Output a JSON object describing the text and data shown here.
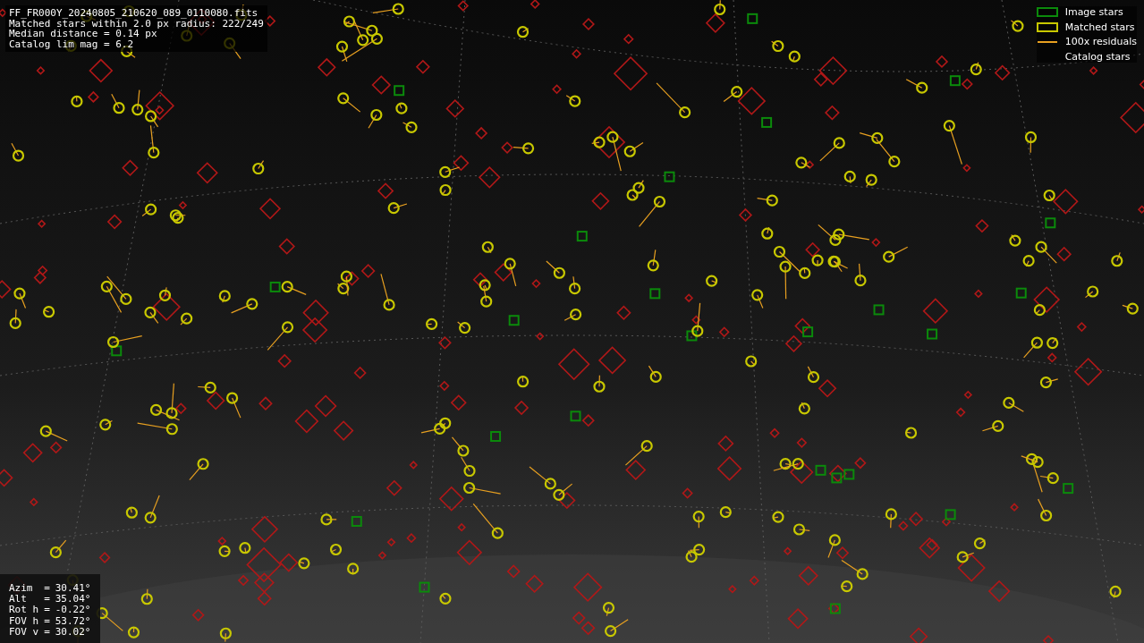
{
  "info_lines": [
    "FF_FR000Y_20240805_210620_089_0110080.fits",
    "Matched stars within 2.0 px radius: 222/249",
    "Median distance = 0.14 px",
    "Catalog lim mag = 6.2"
  ],
  "legend": [
    {
      "label": "Image stars",
      "kind": "box",
      "color": "#0b8a0b"
    },
    {
      "label": "Matched stars",
      "kind": "box",
      "color": "#c8c800"
    },
    {
      "label": "100x residuals",
      "kind": "line",
      "color": "#e8a020"
    },
    {
      "label": "Catalog stars",
      "kind": "blank",
      "color": "#b01818"
    }
  ],
  "pointing": [
    {
      "label": "Azim",
      "sign": "=",
      "value": "30.41°"
    },
    {
      "label": "Alt",
      "sign": "=",
      "value": "35.04°"
    },
    {
      "label": "Rot h",
      "sign": "=",
      "value": "-0.22°"
    },
    {
      "label": "FOV h",
      "sign": "=",
      "value": "53.72°"
    },
    {
      "label": "FOV v",
      "sign": "=",
      "value": "30.02°"
    }
  ]
}
